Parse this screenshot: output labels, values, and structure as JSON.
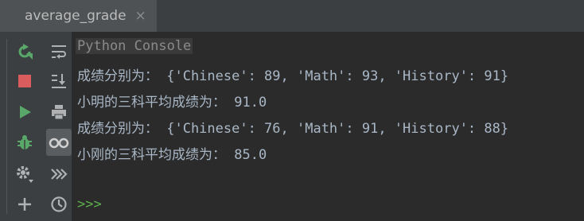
{
  "tab": {
    "title": "average_grade",
    "close_glyph": "×"
  },
  "toolbar": {
    "icons": [
      "rerun-icon",
      "stop-icon",
      "run-icon",
      "debug-icon",
      "settings-icon",
      "add-icon",
      "soft-wrap-icon",
      "scroll-to-end-icon",
      "print-icon",
      "glasses-icon",
      "fast-forward-icon",
      "history-icon"
    ]
  },
  "console": {
    "header": "Python Console",
    "lines": [
      "成绩分别为： {'Chinese': 89, 'Math': 93, 'History': 91}",
      "小明的三科平均成绩为： 91.0",
      "成绩分别为： {'Chinese': 76, 'Math': 91, 'History': 88}",
      "小刚的三科平均成绩为： 85.0"
    ],
    "prompt": ">>>"
  },
  "colors": {
    "background": "#2b2b2b",
    "panel": "#3c3f41",
    "text": "#a9b7c6",
    "prompt": "#5db04c",
    "run_green": "#59a869",
    "stop_red": "#db5c5c"
  }
}
